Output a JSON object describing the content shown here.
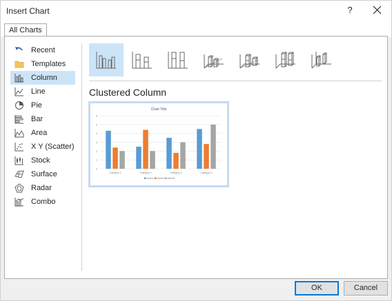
{
  "dialog": {
    "title": "Insert Chart",
    "help_label": "?"
  },
  "tabs": [
    {
      "label": "All Charts"
    }
  ],
  "sidebar": {
    "items": [
      {
        "label": "Recent",
        "icon": "undo-arrow-icon",
        "selected": false
      },
      {
        "label": "Templates",
        "icon": "folder-icon",
        "selected": false
      },
      {
        "label": "Column",
        "icon": "column-chart-icon",
        "selected": true
      },
      {
        "label": "Line",
        "icon": "line-chart-icon",
        "selected": false
      },
      {
        "label": "Pie",
        "icon": "pie-chart-icon",
        "selected": false
      },
      {
        "label": "Bar",
        "icon": "bar-chart-icon",
        "selected": false
      },
      {
        "label": "Area",
        "icon": "area-chart-icon",
        "selected": false
      },
      {
        "label": "X Y (Scatter)",
        "icon": "scatter-chart-icon",
        "selected": false
      },
      {
        "label": "Stock",
        "icon": "stock-chart-icon",
        "selected": false
      },
      {
        "label": "Surface",
        "icon": "surface-chart-icon",
        "selected": false
      },
      {
        "label": "Radar",
        "icon": "radar-chart-icon",
        "selected": false
      },
      {
        "label": "Combo",
        "icon": "combo-chart-icon",
        "selected": false
      }
    ]
  },
  "subtypes": {
    "selected_index": 0,
    "selected_title": "Clustered Column",
    "icons": [
      "clustered-column-icon",
      "stacked-column-icon",
      "100-percent-stacked-column-icon",
      "3d-clustered-column-icon",
      "3d-stacked-column-icon",
      "3d-100-percent-stacked-column-icon",
      "3d-column-icon"
    ]
  },
  "preview": {
    "chart_data": {
      "type": "bar",
      "title": "Chart Title",
      "categories": [
        "Category 1",
        "Category 2",
        "Category 3",
        "Category 4"
      ],
      "series": [
        {
          "name": "Series1",
          "values": [
            4.3,
            2.5,
            3.5,
            4.5
          ],
          "color": "#5b9bd5"
        },
        {
          "name": "Series2",
          "values": [
            2.4,
            4.4,
            1.8,
            2.8
          ],
          "color": "#ed7d31"
        },
        {
          "name": "Series3",
          "values": [
            2,
            2,
            3,
            5
          ],
          "color": "#a5a5a5"
        }
      ],
      "ylim": [
        0,
        6
      ],
      "yticks": [
        "0",
        "1",
        "2",
        "3",
        "4",
        "5",
        "6"
      ],
      "grid": true,
      "legend": "bottom"
    }
  },
  "buttons": {
    "ok": "OK",
    "cancel": "Cancel"
  }
}
